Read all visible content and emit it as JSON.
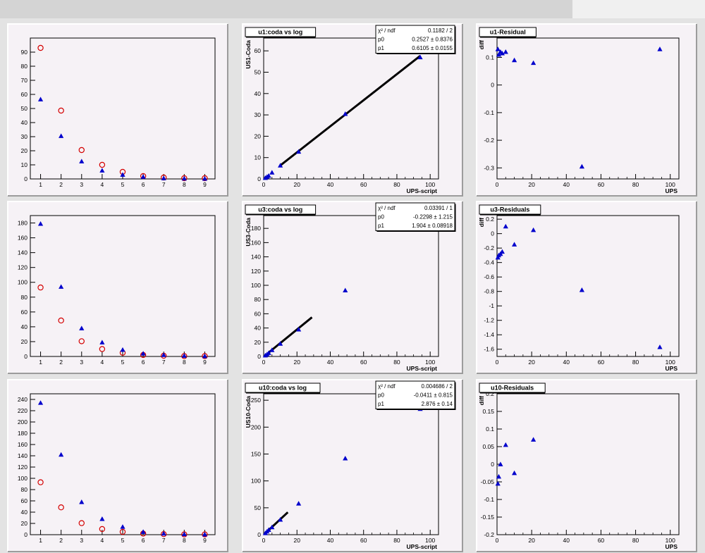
{
  "colors": {
    "canvas": "#e3e3e3",
    "pad": "#f6f2f6",
    "blue": "#0000cc",
    "red": "#d40000",
    "line": "#000000"
  },
  "chart_data": [
    {
      "id": "r0c0",
      "type": "scatter",
      "title": "",
      "xlabel": "",
      "ylabel": "",
      "xlim": [
        0.5,
        9.5
      ],
      "ylim": [
        0,
        100
      ],
      "xticks": [
        1,
        2,
        3,
        4,
        5,
        6,
        7,
        8,
        9
      ],
      "yticks": [
        0,
        10,
        20,
        30,
        40,
        50,
        60,
        70,
        80,
        90
      ],
      "series": [
        {
          "marker": "circle",
          "color": "#d40000",
          "x": [
            1,
            2,
            3,
            4,
            5,
            6,
            7,
            8,
            9
          ],
          "y": [
            93,
            48.5,
            20.5,
            10,
            5,
            2,
            1,
            0.5,
            0.5
          ]
        },
        {
          "marker": "triangle",
          "color": "#0000cc",
          "x": [
            1,
            2,
            3,
            4,
            5,
            6,
            7,
            8,
            9
          ],
          "y": [
            56.5,
            30.5,
            12.5,
            6,
            3,
            1.5,
            0.5,
            0.3,
            0.2
          ]
        }
      ]
    },
    {
      "id": "r0c1",
      "type": "scatter",
      "title": "u1:coda vs log",
      "xlabel": "UPS-script",
      "ylabel": "US1-Coda",
      "xlim": [
        0,
        105
      ],
      "ylim": [
        0,
        66
      ],
      "xticks": [
        0,
        20,
        40,
        60,
        80,
        100
      ],
      "yticks": [
        0,
        10,
        20,
        30,
        40,
        50,
        60
      ],
      "fit": {
        "x": [
          10,
          94
        ],
        "y": [
          6.35,
          57.63
        ]
      },
      "stats": [
        {
          "label": "χ² / ndf",
          "value": "0.1182 / 2"
        },
        {
          "label": "p0",
          "value": "0.2527 ± 0.8376"
        },
        {
          "label": "p1",
          "value": "0.6105 ± 0.0155"
        }
      ],
      "series": [
        {
          "marker": "triangle",
          "color": "#0000cc",
          "x": [
            1,
            2,
            3,
            5,
            10,
            21,
            49,
            94
          ],
          "y": [
            0.5,
            1,
            1.5,
            3,
            6.3,
            12.8,
            30.5,
            57
          ]
        }
      ]
    },
    {
      "id": "r0c2",
      "type": "scatter",
      "title": "u1-Residual",
      "xlabel": "UPS",
      "ylabel": "diff",
      "xlim": [
        0,
        105
      ],
      "ylim": [
        -0.34,
        0.17
      ],
      "xticks": [
        0,
        20,
        40,
        60,
        80,
        100
      ],
      "yticks": [
        -0.3,
        -0.2,
        -0.1,
        0,
        0.1
      ],
      "series": [
        {
          "marker": "triangle",
          "color": "#0000cc",
          "x": [
            0.5,
            1,
            2,
            3,
            5,
            10,
            21,
            49,
            94
          ],
          "y": [
            0.13,
            0.11,
            0.12,
            0.115,
            0.12,
            0.09,
            0.08,
            -0.295,
            0.13
          ]
        }
      ]
    },
    {
      "id": "r1c0",
      "type": "scatter",
      "title": "",
      "xlabel": "",
      "ylabel": "",
      "xlim": [
        0.5,
        9.5
      ],
      "ylim": [
        0,
        190
      ],
      "xticks": [
        1,
        2,
        3,
        4,
        5,
        6,
        7,
        8,
        9
      ],
      "yticks": [
        0,
        20,
        40,
        60,
        80,
        100,
        120,
        140,
        160,
        180
      ],
      "series": [
        {
          "marker": "circle",
          "color": "#d40000",
          "x": [
            1,
            2,
            3,
            4,
            5,
            6,
            7,
            8,
            9
          ],
          "y": [
            93,
            48.5,
            20.5,
            10,
            5,
            2,
            1,
            0.5,
            0.5
          ]
        },
        {
          "marker": "triangle",
          "color": "#0000cc",
          "x": [
            1,
            2,
            3,
            4,
            5,
            6,
            7,
            8,
            9
          ],
          "y": [
            179,
            94,
            38,
            19,
            9,
            4,
            2,
            1,
            0.5
          ]
        }
      ]
    },
    {
      "id": "r1c1",
      "type": "scatter",
      "title": "u3:coda vs log",
      "xlabel": "UPS-script",
      "ylabel": "US3-Coda",
      "xlim": [
        0,
        105
      ],
      "ylim": [
        0,
        198
      ],
      "xticks": [
        0,
        20,
        40,
        60,
        80,
        100
      ],
      "yticks": [
        0,
        20,
        40,
        60,
        80,
        100,
        120,
        140,
        160,
        180
      ],
      "fit": {
        "x": [
          3,
          29
        ],
        "y": [
          5.48,
          54.99
        ]
      },
      "stats": [
        {
          "label": "χ² / ndf",
          "value": "0.03391 / 1"
        },
        {
          "label": "p0",
          "value": "-0.2298 ± 1.215"
        },
        {
          "label": "p1",
          "value": "1.904 ± 0.08918"
        }
      ],
      "series": [
        {
          "marker": "triangle",
          "color": "#0000cc",
          "x": [
            1,
            2,
            3,
            5,
            10,
            21,
            49,
            94
          ],
          "y": [
            1.5,
            3,
            5,
            9,
            18,
            38,
            93,
            179
          ]
        }
      ]
    },
    {
      "id": "r1c2",
      "type": "scatter",
      "title": "u3-Residuals",
      "xlabel": "UPS",
      "ylabel": "diff",
      "xlim": [
        0,
        105
      ],
      "ylim": [
        -1.7,
        0.25
      ],
      "xticks": [
        0,
        20,
        40,
        60,
        80,
        100
      ],
      "yticks": [
        -1.6,
        -1.4,
        -1.2,
        -1,
        -0.8,
        -0.6,
        -0.4,
        -0.2,
        0,
        0.2
      ],
      "series": [
        {
          "marker": "triangle",
          "color": "#0000cc",
          "x": [
            0.5,
            1,
            2,
            3,
            5,
            10,
            21,
            49,
            94
          ],
          "y": [
            -0.33,
            -0.3,
            -0.28,
            -0.25,
            0.1,
            -0.15,
            0.05,
            -0.78,
            -1.57
          ]
        }
      ]
    },
    {
      "id": "r2c0",
      "type": "scatter",
      "title": "",
      "xlabel": "",
      "ylabel": "",
      "xlim": [
        0.5,
        9.5
      ],
      "ylim": [
        0,
        250
      ],
      "xticks": [
        1,
        2,
        3,
        4,
        5,
        6,
        7,
        8,
        9
      ],
      "yticks": [
        0,
        20,
        40,
        60,
        80,
        100,
        120,
        140,
        160,
        180,
        200,
        220,
        240
      ],
      "series": [
        {
          "marker": "circle",
          "color": "#d40000",
          "x": [
            1,
            2,
            3,
            4,
            5,
            6,
            7,
            8,
            9
          ],
          "y": [
            93,
            48.5,
            20.5,
            10,
            5,
            2,
            1,
            0.5,
            0.5
          ]
        },
        {
          "marker": "triangle",
          "color": "#0000cc",
          "x": [
            1,
            2,
            3,
            4,
            5,
            6,
            7,
            8,
            9
          ],
          "y": [
            234,
            142,
            58,
            28,
            14,
            5,
            2,
            1,
            0.5
          ]
        }
      ]
    },
    {
      "id": "r2c1",
      "type": "scatter",
      "title": "u10:coda vs log",
      "xlabel": "UPS-script",
      "ylabel": "US10-Coda",
      "xlim": [
        0,
        105
      ],
      "ylim": [
        0,
        262
      ],
      "xticks": [
        0,
        20,
        40,
        60,
        80,
        100
      ],
      "yticks": [
        0,
        50,
        100,
        150,
        200,
        250
      ],
      "fit": {
        "x": [
          1,
          14.5
        ],
        "y": [
          2.83,
          41.66
        ]
      },
      "stats": [
        {
          "label": "χ² / ndf",
          "value": "0.004686 / 2"
        },
        {
          "label": "p0",
          "value": "-0.0411 ± 0.815"
        },
        {
          "label": "p1",
          "value": "2.876 ± 0.14"
        }
      ],
      "series": [
        {
          "marker": "triangle",
          "color": "#0000cc",
          "x": [
            1,
            2,
            3,
            5,
            10,
            21,
            49,
            94
          ],
          "y": [
            3,
            6,
            9,
            14,
            28,
            58,
            142,
            234
          ]
        }
      ]
    },
    {
      "id": "r2c2",
      "type": "scatter",
      "title": "u10-Residuals",
      "xlabel": "UPS",
      "ylabel": "diff",
      "xlim": [
        0,
        105
      ],
      "ylim": [
        -0.2,
        0.2
      ],
      "xticks": [
        0,
        20,
        40,
        60,
        80,
        100
      ],
      "yticks": [
        -0.2,
        -0.15,
        -0.1,
        -0.05,
        0,
        0.05,
        0.1,
        0.15,
        0.2
      ],
      "series": [
        {
          "marker": "triangle",
          "color": "#0000cc",
          "x": [
            0.5,
            1,
            2,
            5,
            10,
            21
          ],
          "y": [
            -0.055,
            -0.035,
            0.0,
            0.055,
            -0.025,
            0.07
          ]
        }
      ]
    }
  ]
}
